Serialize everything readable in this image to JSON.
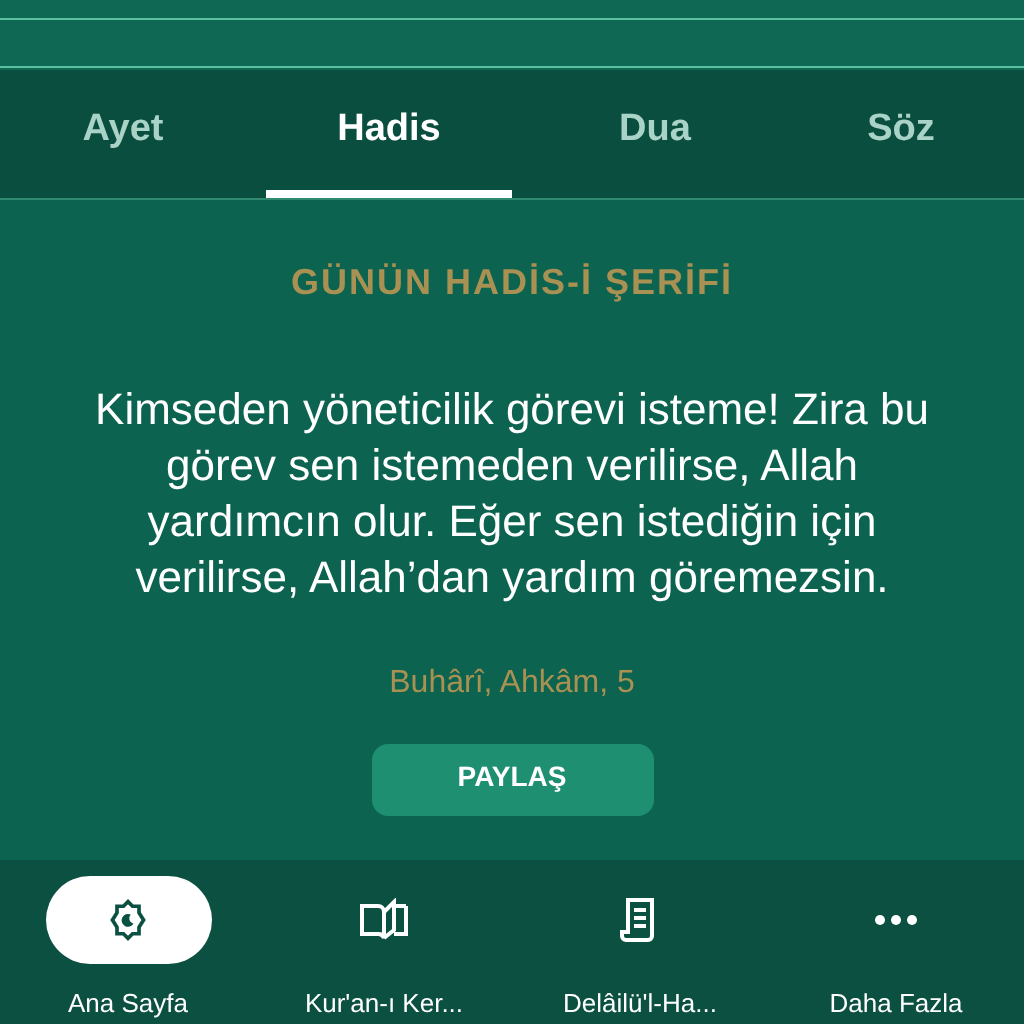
{
  "tabs": [
    {
      "label": "Ayet",
      "selected": false
    },
    {
      "label": "Hadis",
      "selected": true
    },
    {
      "label": "Dua",
      "selected": false
    },
    {
      "label": "Söz",
      "selected": false
    }
  ],
  "card": {
    "title": "GÜNÜN HADİS-İ ŞERİFİ",
    "text": "Kimseden yöneticilik görevi isteme! Zira bu görev sen istemeden verilirse, Allah yardımcın olur. Eğer sen istediğin için verilirse, Allah’dan yardım göremezsin.",
    "source": "Buhârî, Ahkâm, 5",
    "share_button": "PAYLAŞ"
  },
  "bottom_nav": [
    {
      "kind": "home",
      "label": "Ana Sayfa",
      "selected": true
    },
    {
      "kind": "book",
      "label": "Kur'an-ı Ker...",
      "selected": false
    },
    {
      "kind": "scroll",
      "label": "Delâilü'l-Ha...",
      "selected": false
    },
    {
      "kind": "more",
      "label": "Daha Fazla",
      "selected": false
    }
  ]
}
